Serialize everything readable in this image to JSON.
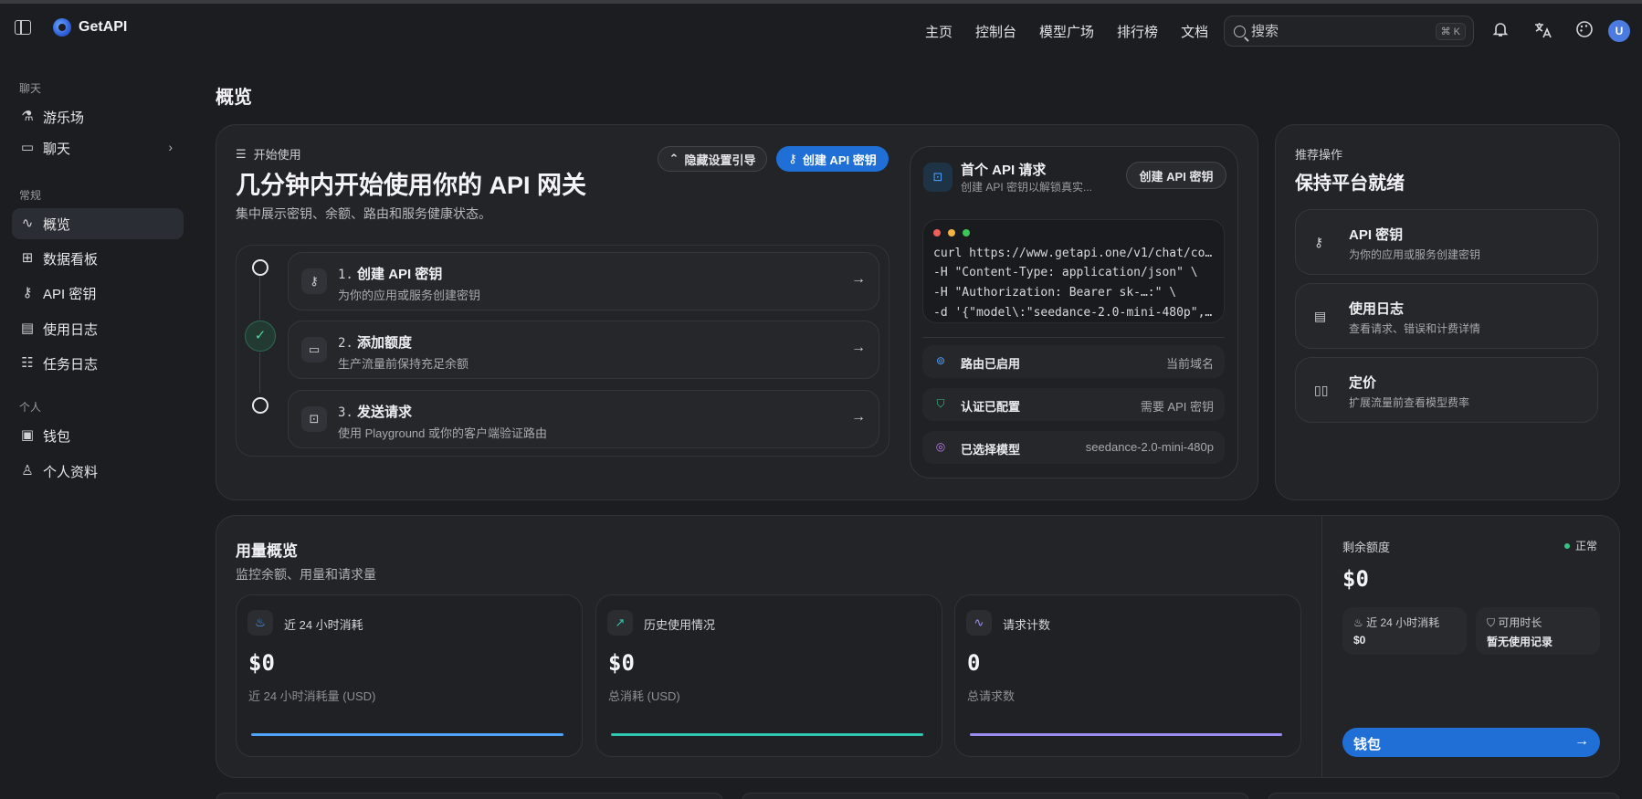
{
  "header": {
    "brand": "GetAPI",
    "nav": [
      "主页",
      "控制台",
      "模型广场",
      "排行榜",
      "文档"
    ],
    "search_placeholder": "搜索",
    "search_shortcut": "⌘ K",
    "avatar_initial": "U"
  },
  "sidebar": {
    "section_chat": "聊天",
    "section_general": "常规",
    "section_personal": "个人",
    "items": [
      {
        "label": "游乐场",
        "icon": "flask-icon"
      },
      {
        "label": "聊天",
        "icon": "chat-icon"
      },
      {
        "label": "概览",
        "icon": "activity-icon",
        "active": true
      },
      {
        "label": "数据看板",
        "icon": "grid-icon"
      },
      {
        "label": "API 密钥",
        "icon": "key-icon"
      },
      {
        "label": "使用日志",
        "icon": "file-icon"
      },
      {
        "label": "任务日志",
        "icon": "list-check-icon"
      },
      {
        "label": "钱包",
        "icon": "wallet-icon"
      },
      {
        "label": "个人资料",
        "icon": "user-icon"
      }
    ]
  },
  "page": {
    "title": "概览"
  },
  "getting_started": {
    "label": "开始使用",
    "title": "几分钟内开始使用你的 API 网关",
    "subtitle": "集中展示密钥、余额、路由和服务健康状态。",
    "hide_guide": "隐藏设置引导",
    "create_key": "创建 API 密钥",
    "steps": [
      {
        "num": "1.",
        "title": "创建 API 密钥",
        "desc": "为你的应用或服务创建密钥",
        "state": "pending"
      },
      {
        "num": "2.",
        "title": "添加额度",
        "desc": "生产流量前保持充足余额",
        "state": "done"
      },
      {
        "num": "3.",
        "title": "发送请求",
        "desc": "使用 Playground 或你的客户端验证路由",
        "state": "pending"
      }
    ]
  },
  "first_request": {
    "title": "首个 API 请求",
    "subtitle": "创建 API 密钥以解锁真实...",
    "button": "创建 API 密钥",
    "code": [
      "curl https://www.getapi.one/v1/chat/co…",
      "-H \"Content-Type: application/json\" \\",
      "-H \"Authorization: Bearer sk-…:\" \\",
      "-d '{\"model\\:\"seedance-2.0-mini-480p\",…"
    ],
    "rows": [
      {
        "key": "路由已启用",
        "value": "当前域名",
        "color": "#4fa3ff"
      },
      {
        "key": "认证已配置",
        "value": "需要 API 密钥",
        "color": "#33c481"
      },
      {
        "key": "已选择模型",
        "value": "seedance-2.0-mini-480p",
        "color": "#c07cf2"
      }
    ]
  },
  "recommended": {
    "label": "推荐操作",
    "title": "保持平台就绪",
    "items": [
      {
        "title": "API 密钥",
        "desc": "为你的应用或服务创建密钥"
      },
      {
        "title": "使用日志",
        "desc": "查看请求、错误和计费详情"
      },
      {
        "title": "定价",
        "desc": "扩展流量前查看模型费率"
      }
    ]
  },
  "usage": {
    "title": "用量概览",
    "subtitle": "监控余额、用量和请求量",
    "metrics": [
      {
        "label": "近 24 小时消耗",
        "value": "$0",
        "desc": "近 24 小时消耗量 (USD)",
        "color": "#4fa3ff"
      },
      {
        "label": "历史使用情况",
        "value": "$0",
        "desc": "总消耗 (USD)",
        "color": "#2fc7b0"
      },
      {
        "label": "请求计数",
        "value": "0",
        "desc": "总请求数",
        "color": "#9b8cf2"
      }
    ]
  },
  "balance": {
    "label": "剩余额度",
    "status": "正常",
    "value": "$0",
    "mini": [
      {
        "label": "近 24 小时消耗",
        "value": "$0"
      },
      {
        "label": "可用时长",
        "value": "暂无使用记录"
      }
    ],
    "wallet": "钱包"
  }
}
